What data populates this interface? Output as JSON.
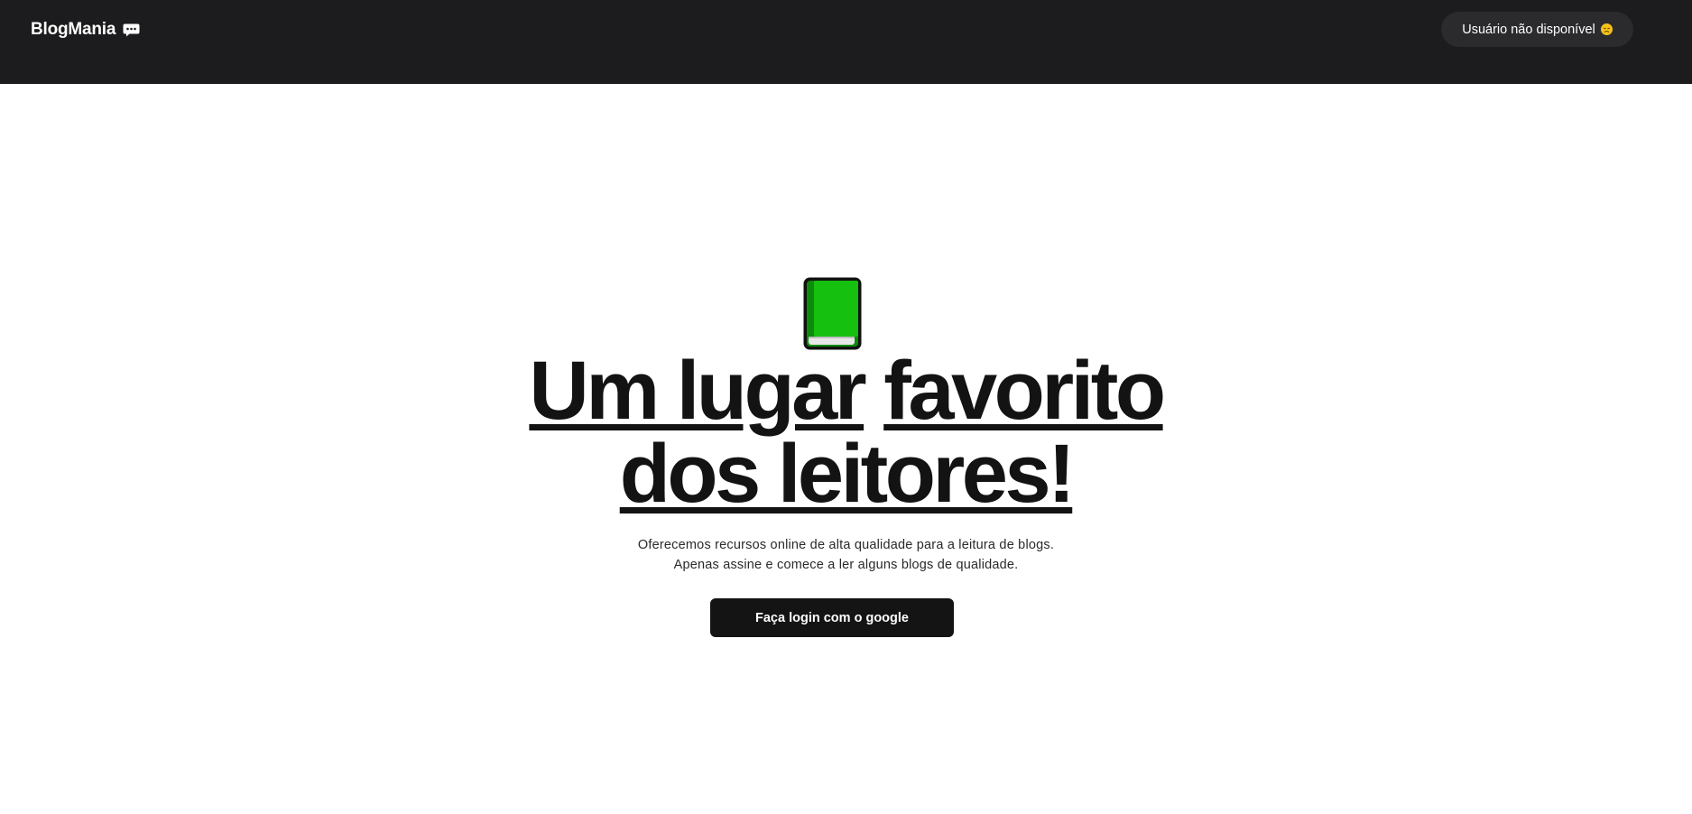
{
  "header": {
    "brand_name": "BlogMania",
    "brand_icon": "speech-balloon-icon",
    "user_status_label": "Usuário não disponível",
    "user_status_icon": "disappointed-face-icon"
  },
  "hero": {
    "icon": "green-book-icon",
    "headline_line1_part1": "Um lugar",
    "headline_line1_part2": "favorito",
    "headline_line2": "dos leitores!",
    "subtitle_line1": "Oferecemos recursos online de alta qualidade para a leitura de blogs.",
    "subtitle_line2": "Apenas assine e comece a ler alguns blogs de qualidade.",
    "login_button_label": "Faça login com o google"
  },
  "colors": {
    "header_bg": "#1c1c1e",
    "pill_bg": "#2b2b2e",
    "text_dark": "#131313",
    "button_bg": "#141414",
    "book_green": "#16c00f"
  }
}
